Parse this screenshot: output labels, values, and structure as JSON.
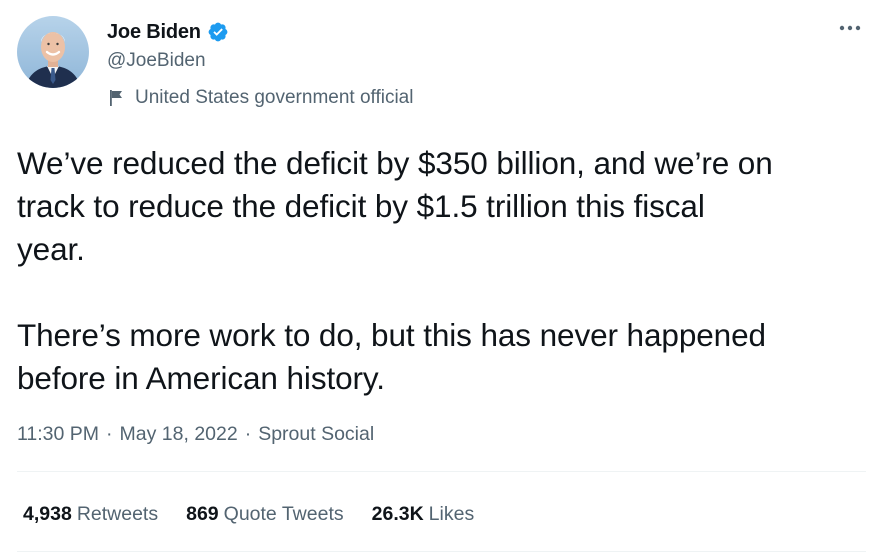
{
  "author": {
    "display_name": "Joe Biden",
    "handle": "@JoeBiden",
    "label": "United States government official",
    "verified_icon": "verified-badge-icon",
    "avatar_icon": "profile-avatar"
  },
  "tweet": {
    "text": "We’ve reduced the deficit by $350 billion, and we’re on\ntrack to reduce the deficit by $1.5 trillion this fiscal\nyear.\n\nThere’s more work to do, but this has never happened\nbefore in American history."
  },
  "meta": {
    "time": "11:30 PM",
    "separator_1": "·",
    "date": "May 18, 2022",
    "separator_2": "·",
    "source": "Sprout Social"
  },
  "stats": {
    "retweets_count": "4,938",
    "retweets_label": "Retweets",
    "quotes_count": "869",
    "quotes_label": "Quote Tweets",
    "likes_count": "26.3K",
    "likes_label": "Likes"
  },
  "colors": {
    "verified_blue": "#1d9bf0",
    "secondary_text": "#536471",
    "primary_text": "#0f1419",
    "divider": "#eff3f4"
  }
}
